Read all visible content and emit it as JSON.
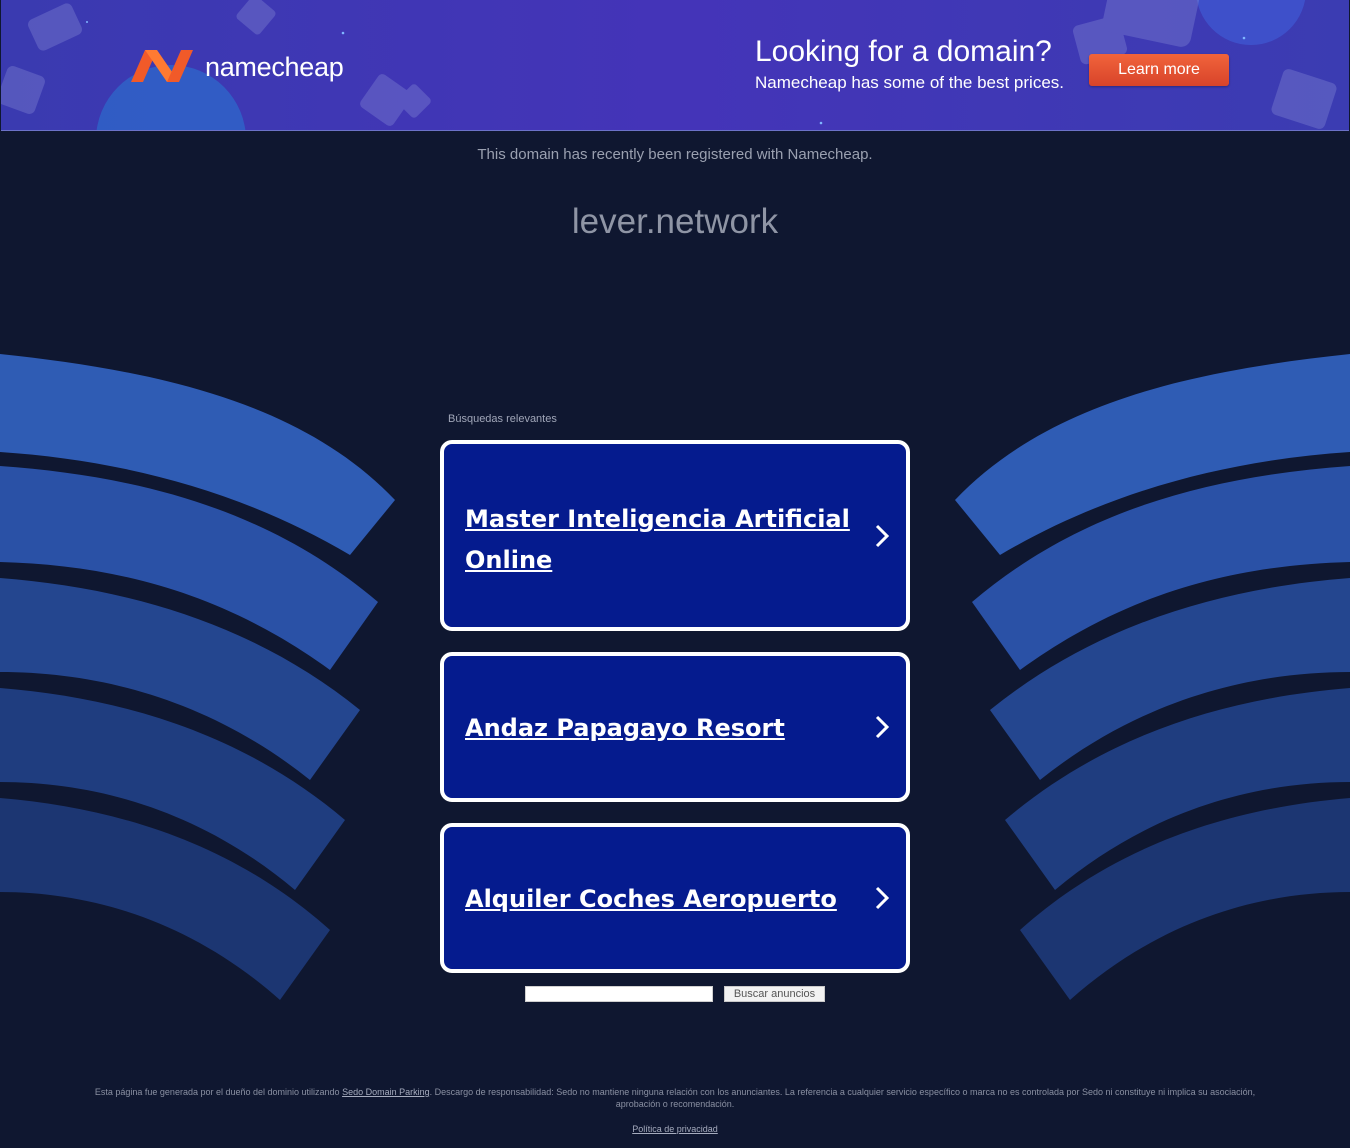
{
  "banner": {
    "brand": "namecheap",
    "promo_title": "Looking for a domain?",
    "promo_subtitle": "Namecheap has some of the best prices.",
    "cta_label": "Learn more",
    "brand_color": "#f15a29",
    "background_color": "#4034b4"
  },
  "main": {
    "registered_note": "This domain has recently been registered with Namecheap.",
    "domain": "lever.network",
    "related_label": "Búsquedas relevantes",
    "results": [
      {
        "label": "Master Inteligencia Artificial Online"
      },
      {
        "label": "Andaz Papagayo Resort"
      },
      {
        "label": "Alquiler Coches Aeropuerto"
      }
    ],
    "card_color": "#051b8e",
    "search": {
      "input_value": "",
      "button_label": "Buscar anuncios"
    }
  },
  "footer": {
    "disclaimer_before": "Esta página fue generada por el dueño del dominio utilizando ",
    "disclaimer_link": "Sedo Domain Parking",
    "disclaimer_after": ". Descargo de responsabilidad: Sedo no mantiene ninguna relación con los anunciantes. La referencia a cualquier servicio específico o marca no es controlada por Sedo ni constituye ni implica su asociación, aprobación o recomendación.",
    "privacy_label": "Política de privacidad"
  },
  "icons": {
    "logo": "namecheap-logo-icon",
    "chevron": "chevron-right-icon"
  }
}
